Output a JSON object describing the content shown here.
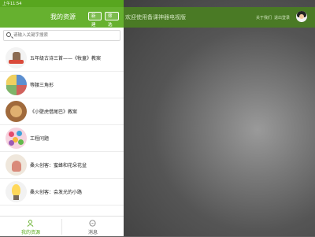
{
  "statusbar": {
    "time": "上午11:54",
    "battery": ""
  },
  "main": {
    "title": "欢迎使用备课神器电视版",
    "link1": "关于我们",
    "link2": "退出登录"
  },
  "sidebar": {
    "title": "我的资源",
    "buttons": [
      "新建",
      "筛选"
    ],
    "search_placeholder": "请输入关键字搜索",
    "items": [
      {
        "label": "五年级古诗三首——《牧童》教案",
        "thumb": "shepherd-boy"
      },
      {
        "label": "等腰三角形",
        "thumb": "triangles-collage"
      },
      {
        "label": "《小壁虎借尾巴》教案",
        "thumb": "gecko"
      },
      {
        "label": "工程问题",
        "thumb": "colorful-collage"
      },
      {
        "label": "桑火创客：蜜蜂和花朵花盆",
        "thumb": "bee-flowerpot"
      },
      {
        "label": "桑火创客：会发光的小路",
        "thumb": "glowing-path"
      }
    ]
  },
  "tabs": [
    {
      "label": "我的资源",
      "icon": "person-icon",
      "active": true
    },
    {
      "label": "消息",
      "icon": "chat-bubble-icon",
      "active": false
    }
  ],
  "colors": {
    "accent": "#66b12f",
    "statusbar": "#58a61f",
    "tab_active": "#5cab1f"
  }
}
